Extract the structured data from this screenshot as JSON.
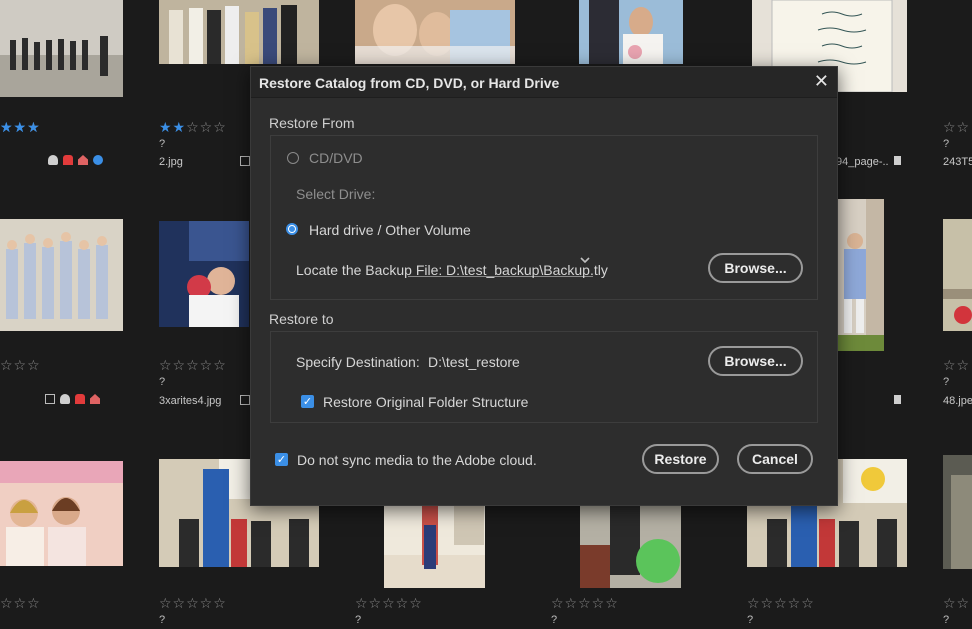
{
  "dialog": {
    "title": "Restore Catalog from CD, DVD, or Hard Drive",
    "close_glyph": "✕",
    "restore_from": {
      "label": "Restore From",
      "cd_option": "CD/DVD",
      "select_drive_label": "Select Drive:",
      "select_drive_value": "",
      "hard_drive_option": "Hard drive / Other Volume",
      "locate_label": "Locate the Backup File:",
      "locate_value": "D:\\test_backup\\Backup.tly",
      "browse_label": "Browse..."
    },
    "restore_to": {
      "label": "Restore to",
      "destination_label": "Specify Destination:",
      "destination_value": "D:\\test_restore",
      "browse_label": "Browse...",
      "folder_structure_label": "Restore Original Folder Structure",
      "folder_structure_checked": true
    },
    "no_sync_label": "Do not sync media to the Adobe cloud.",
    "no_sync_checked": true,
    "restore_button": "Restore",
    "cancel_button": "Cancel",
    "selected_option": "hard-drive"
  },
  "grid": {
    "star_glyph_filled": "★",
    "star_glyph_empty": "☆",
    "items": [
      {
        "name": "",
        "meta": "",
        "rating": 3
      },
      {
        "name": "2.jpg",
        "meta": "?",
        "rating": 2
      },
      {
        "name": "94_page-..",
        "meta": "",
        "rating": 0
      },
      {
        "name": "243T5",
        "meta": "?",
        "rating": 0
      },
      {
        "name": "",
        "meta": "",
        "rating": 0
      },
      {
        "name": "3xarites4.jpg",
        "meta": "?",
        "rating": 0
      },
      {
        "name": "48.jpe",
        "meta": "?",
        "rating": 0
      },
      {
        "name": "",
        "meta": "",
        "rating": 0
      },
      {
        "name": "",
        "meta": "?",
        "rating": 0
      },
      {
        "name": "",
        "meta": "?",
        "rating": 0
      },
      {
        "name": "",
        "meta": "?",
        "rating": 0
      },
      {
        "name": "",
        "meta": "?",
        "rating": 0
      },
      {
        "name": "",
        "meta": "?",
        "rating": 0
      }
    ]
  },
  "colors": {
    "accent": "#3b8fe6",
    "background": "#1b1b1b",
    "dialog": "#2d2d2d"
  }
}
